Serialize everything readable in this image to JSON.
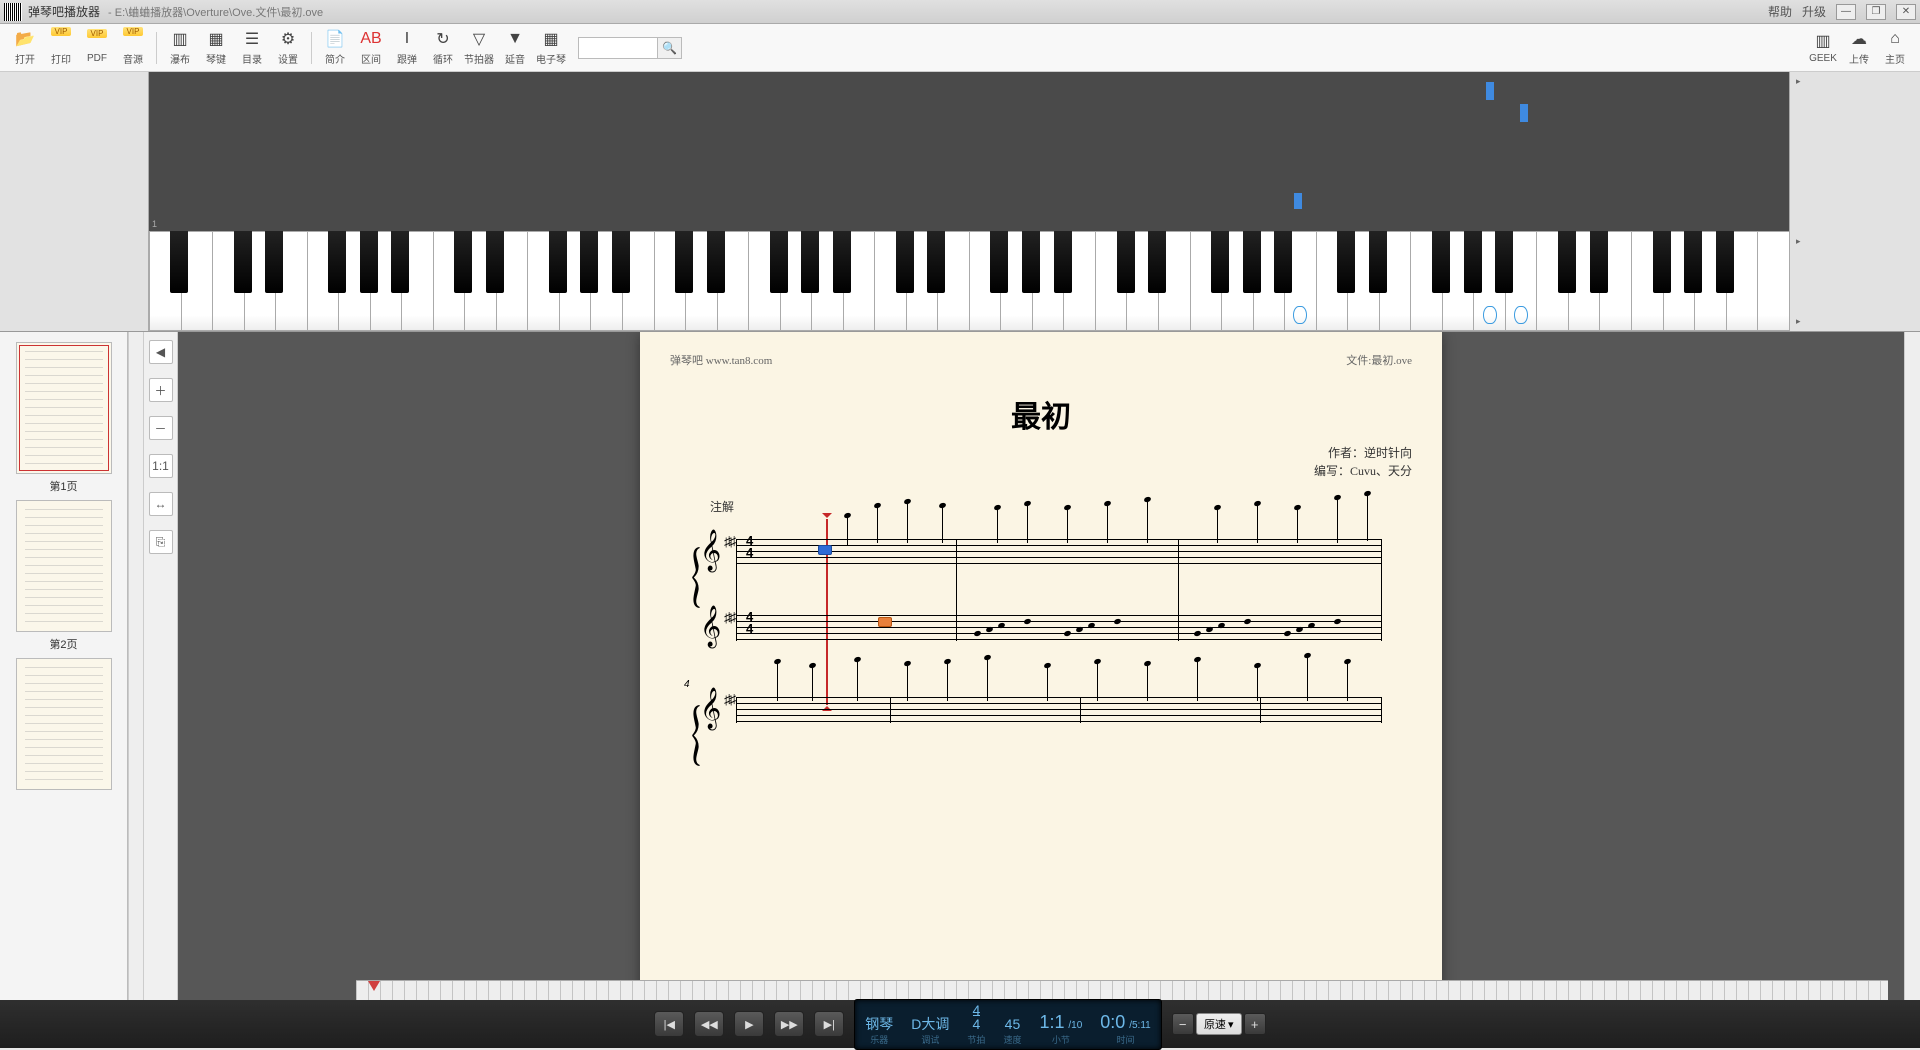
{
  "titlebar": {
    "app": "弹琴吧播放器",
    "path": "- E:\\蛐蛐播放器\\Overture\\Ove.文件\\最初.ove",
    "help": "帮助",
    "upgrade": "升级"
  },
  "toolbar": {
    "open": "打开",
    "print": "打印",
    "pdf": "PDF",
    "sound": "音源",
    "waterfall": "瀑布",
    "keys": "琴键",
    "toc": "目录",
    "settings": "设置",
    "intro": "简介",
    "section": "区间",
    "follow": "跟弹",
    "loop": "循环",
    "metronome": "节拍器",
    "sustain": "延音",
    "epiano": "电子琴",
    "geek": "GEEK",
    "upload": "上传",
    "home": "主页"
  },
  "roll": {
    "measure": "1"
  },
  "thumbs": {
    "p1": "第1页",
    "p2": "第2页"
  },
  "score": {
    "site": "弹琴吧 www.tan8.com",
    "filelabel": "文件:最初.ove",
    "title": "最初",
    "author": "作者：逆时针向",
    "arranger": "编写：Cuvu、天分",
    "annotation": "注解",
    "timesig_top": "4",
    "timesig_bot": "4",
    "meas4": "4"
  },
  "transport": {
    "instrument": "钢琴",
    "instrument_l": "乐器",
    "key": "D大调",
    "key_l": "调试",
    "beat": "4",
    "beat_bot": "4",
    "beat_l": "节拍",
    "tempo": "45",
    "tempo_l": "速度",
    "bar": "1:1",
    "bar_total": "/10",
    "bar_l": "小节",
    "time": "0:0",
    "time_total": "/5:11",
    "time_l": "时间",
    "speed": "原速"
  }
}
